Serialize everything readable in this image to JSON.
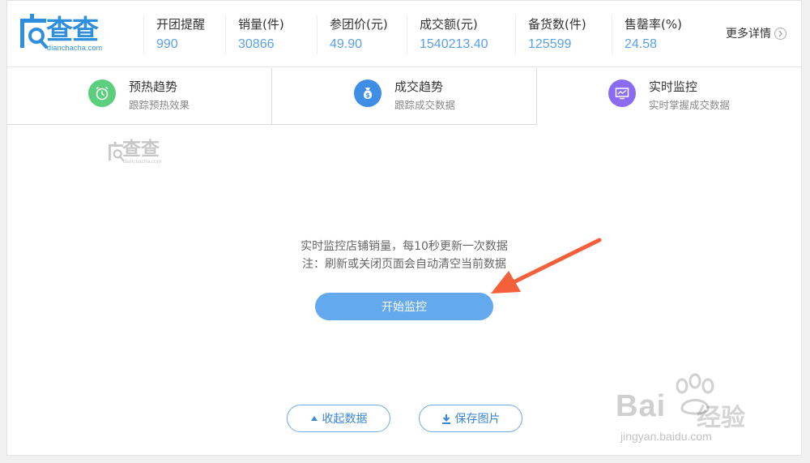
{
  "logo": {
    "brand": "查查",
    "sub": "dianchacha.com"
  },
  "stats": [
    {
      "label": "开团提醒",
      "value": "990"
    },
    {
      "label": "销量(件)",
      "value": "30866"
    },
    {
      "label": "参团价(元)",
      "value": "49.90"
    },
    {
      "label": "成交额(元)",
      "value": "1540213.40"
    },
    {
      "label": "备货数(件)",
      "value": "125599"
    },
    {
      "label": "售罄率(%)",
      "value": "24.58"
    }
  ],
  "more": {
    "label": "更多详情",
    "icon": "chevron-right-icon"
  },
  "tabs": [
    {
      "title": "预热趋势",
      "subtitle": "跟踪预热效果",
      "icon": "alarm-clock-icon",
      "color": "#5bcf7e"
    },
    {
      "title": "成交趋势",
      "subtitle": "跟踪成交数据",
      "icon": "money-bag-icon",
      "color": "#3d8ee4"
    },
    {
      "title": "实时监控",
      "subtitle": "实时掌握成交数据",
      "icon": "monitor-chart-icon",
      "color": "#8b6cf0"
    }
  ],
  "watermark": {
    "brand": "查查",
    "sub": "dianchacha.com"
  },
  "monitor": {
    "line1": "实时监控店铺销量，每10秒更新一次数据",
    "line2": "注：刷新或关闭页面会自动清空当前数据",
    "start_label": "开始监控"
  },
  "actions": {
    "collapse_label": "收起数据",
    "save_label": "保存图片"
  },
  "baidu": {
    "brand": "Bai",
    "brand2": "经验",
    "url": "jingyan.baidu.com"
  },
  "colors": {
    "accent": "#64a9ee",
    "annotation_arrow": "#f4603a"
  }
}
